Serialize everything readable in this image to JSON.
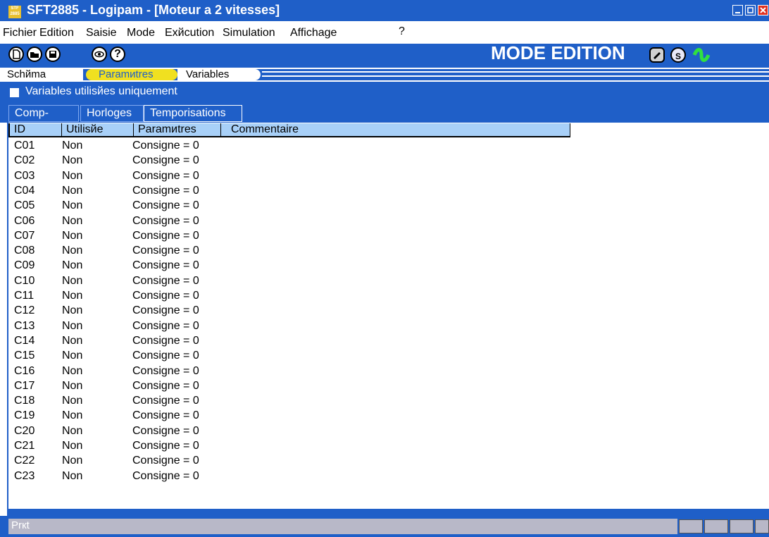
{
  "window": {
    "title": "SFT2885 - Logipam - [Moteur a 2 vitesses]",
    "icon_text": "STF 2885"
  },
  "menu": [
    "Fichier",
    "Edition",
    "Saisie",
    "Mode",
    "Exйcution",
    "Simulation",
    "Affichage",
    "?"
  ],
  "toolbar": {
    "mode_label": "MODE EDITION",
    "s_label": "S"
  },
  "tabs": [
    "Schйma",
    "Paramиtres",
    "Variables"
  ],
  "active_tab": "Paramиtres",
  "filter": {
    "label": "Variables utilisйes uniquement",
    "checked": false
  },
  "subtabs": [
    "Comp-",
    "Horloges",
    "Temporisations"
  ],
  "table": {
    "headers": [
      "ID",
      "Utilisйe",
      "Paramиtres",
      "Commentaire"
    ],
    "rows": [
      [
        "C01",
        "Non",
        "Consigne = 0"
      ],
      [
        "C02",
        "Non",
        "Consigne = 0"
      ],
      [
        "C03",
        "Non",
        "Consigne = 0"
      ],
      [
        "C04",
        "Non",
        "Consigne = 0"
      ],
      [
        "C05",
        "Non",
        "Consigne = 0"
      ],
      [
        "C06",
        "Non",
        "Consigne = 0"
      ],
      [
        "C07",
        "Non",
        "Consigne = 0"
      ],
      [
        "C08",
        "Non",
        "Consigne = 0"
      ],
      [
        "C09",
        "Non",
        "Consigne = 0"
      ],
      [
        "C10",
        "Non",
        "Consigne = 0"
      ],
      [
        "C11",
        "Non",
        "Consigne = 0"
      ],
      [
        "C12",
        "Non",
        "Consigne = 0"
      ],
      [
        "C13",
        "Non",
        "Consigne = 0"
      ],
      [
        "C14",
        "Non",
        "Consigne = 0"
      ],
      [
        "C15",
        "Non",
        "Consigne = 0"
      ],
      [
        "C16",
        "Non",
        "Consigne = 0"
      ],
      [
        "C17",
        "Non",
        "Consigne = 0"
      ],
      [
        "C18",
        "Non",
        "Consigne = 0"
      ],
      [
        "C19",
        "Non",
        "Consigne = 0"
      ],
      [
        "C20",
        "Non",
        "Consigne = 0"
      ],
      [
        "C21",
        "Non",
        "Consigne = 0"
      ],
      [
        "C22",
        "Non",
        "Consigne = 0"
      ],
      [
        "C23",
        "Non",
        "Consigne = 0"
      ]
    ]
  },
  "status": {
    "text": "Prкt"
  },
  "colors": {
    "accent": "#1f5fc8",
    "header_bg": "#a8d0f8",
    "active_tab": "#f0e020"
  }
}
